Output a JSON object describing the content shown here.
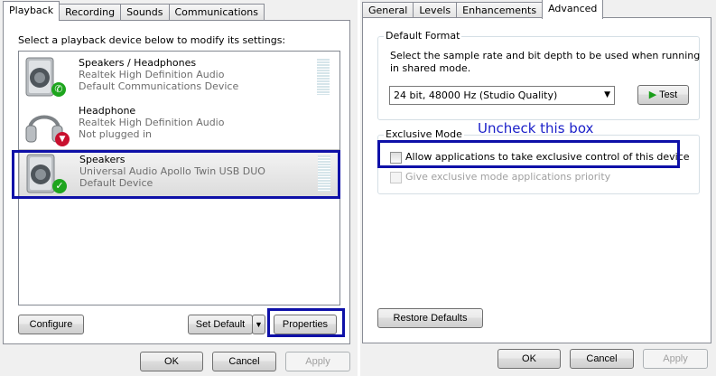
{
  "left": {
    "tabs": [
      "Playback",
      "Recording",
      "Sounds",
      "Communications"
    ],
    "instructions": "Select a playback device below to modify its settings:",
    "devices": [
      {
        "name": "Speakers / Headphones",
        "driver": "Realtek High Definition Audio",
        "status": "Default Communications Device",
        "icon": "speaker-icon",
        "badge": "phone-badge-icon",
        "badge_color": "#1ea51e"
      },
      {
        "name": "Headphone",
        "driver": "Realtek High Definition Audio",
        "status": "Not plugged in",
        "icon": "headphone-icon",
        "badge": "unplugged-badge-icon",
        "badge_color": "#c8102e"
      },
      {
        "name": "Speakers",
        "driver": "Universal Audio Apollo Twin USB DUO",
        "status": "Default Device",
        "icon": "speaker-icon",
        "badge": "checkmark-badge-icon",
        "badge_color": "#1ea51e",
        "selected": true
      }
    ],
    "buttons": {
      "configure": "Configure",
      "set_default": "Set Default",
      "properties": "Properties"
    },
    "footer": {
      "ok": "OK",
      "cancel": "Cancel",
      "apply": "Apply"
    }
  },
  "right": {
    "tabs": [
      "General",
      "Levels",
      "Enhancements",
      "Advanced"
    ],
    "default_format": {
      "legend": "Default Format",
      "description_line1": "Select the sample rate and bit depth to be used when running",
      "description_line2": "in shared mode.",
      "selected_format": "24 bit, 48000 Hz (Studio Quality)",
      "test_label": "Test"
    },
    "annotation": "Uncheck this box",
    "exclusive_mode": {
      "legend": "Exclusive Mode",
      "allow_exclusive_label": "Allow applications to take exclusive control of this device",
      "allow_exclusive_checked": false,
      "priority_label": "Give exclusive mode applications priority",
      "priority_checked": false
    },
    "restore_defaults": "Restore Defaults",
    "footer": {
      "ok": "OK",
      "cancel": "Cancel",
      "apply": "Apply"
    }
  },
  "colors": {
    "highlight": "#0e10a8",
    "annotation": "#1c21c9",
    "test_arrow": "#1a9e1a"
  }
}
